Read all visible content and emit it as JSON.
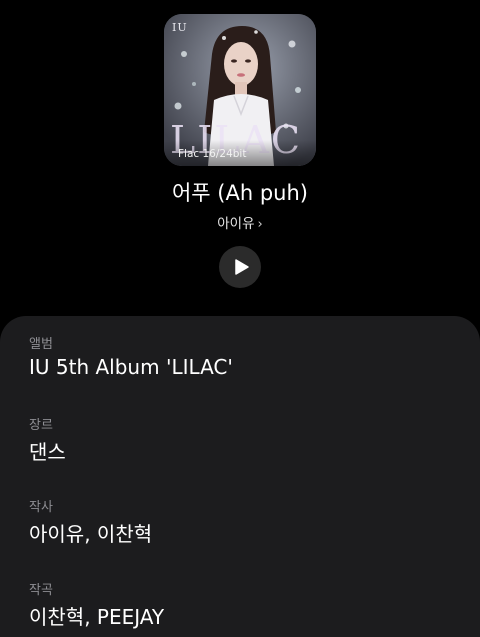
{
  "album_art": {
    "artist_mark": "IU",
    "cover_wordmark": "LILAC",
    "quality_label": "Flac 16/24bit"
  },
  "track": {
    "title": "어푸 (Ah puh)",
    "artist": "아이유",
    "artist_chevron": "›"
  },
  "controls": {
    "play_icon": "play-icon"
  },
  "details": {
    "album": {
      "label": "앨범",
      "value": "IU 5th Album 'LILAC'"
    },
    "genre": {
      "label": "장르",
      "value": "댄스"
    },
    "lyricist": {
      "label": "작사",
      "value": "아이유, 이찬혁"
    },
    "composer": {
      "label": "작곡",
      "value": "이찬혁, PEEJAY"
    }
  },
  "colors": {
    "background": "#000000",
    "panel": "#1c1c1e",
    "label": "#8e8e93",
    "text": "#ffffff",
    "play_button": "#2b2b2b"
  }
}
